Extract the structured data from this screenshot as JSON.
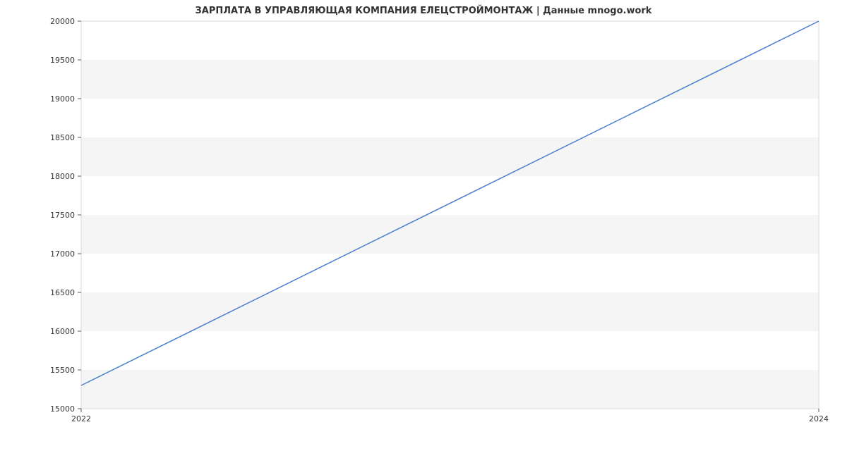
{
  "title": "ЗАРПЛАТА В УПРАВЛЯЮЩАЯ КОМПАНИЯ ЕЛЕЦСТРОЙМОНТАЖ | Данные mnogo.work",
  "chart_data": {
    "type": "line",
    "x": [
      2022,
      2024
    ],
    "values": [
      15300,
      20000
    ],
    "title": "ЗАРПЛАТА В УПРАВЛЯЮЩАЯ КОМПАНИЯ ЕЛЕЦСТРОЙМОНТАЖ | Данные mnogo.work",
    "xlabel": "",
    "ylabel": "",
    "xlim": [
      2022,
      2024
    ],
    "ylim": [
      15000,
      20000
    ],
    "xticks": [
      2022,
      2024
    ],
    "yticks": [
      15000,
      15500,
      16000,
      16500,
      17000,
      17500,
      18000,
      18500,
      19000,
      19500,
      20000
    ],
    "grid": "horizontal-bands",
    "line_color": "#4a7ecf"
  }
}
